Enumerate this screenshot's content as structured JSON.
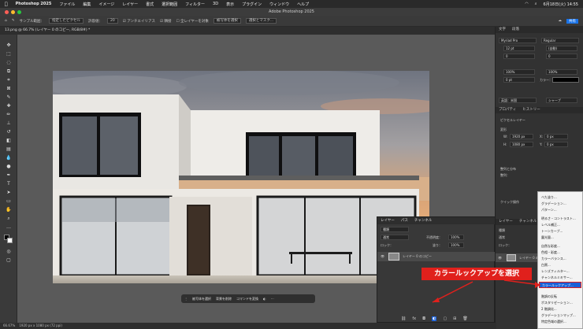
{
  "menubar": {
    "app": "Photoshop 2025",
    "items": [
      "ファイル",
      "編集",
      "イメージ",
      "レイヤー",
      "書式",
      "選択範囲",
      "フィルター",
      "3D",
      "表示",
      "プラグイン",
      "ウィンドウ",
      "ヘルプ"
    ],
    "clock": "6月18日(火) 14:55"
  },
  "titlebar": {
    "title": "Adobe Photoshop 2025"
  },
  "options": {
    "sample_size_label": "サンプル範囲：",
    "sample_size": "指定したピクセル",
    "tolerance_label": "許容値：",
    "tolerance": "20",
    "antialias": "アンチエイリアス",
    "contiguous": "隣接",
    "all_layers": "全レイヤーを対象",
    "select_subject": "被写体を選択",
    "select_mask": "選択とマスク..."
  },
  "document": {
    "tab": "13.png @ 66.7% (レイヤー 0 のコピー, RGB/8#) *"
  },
  "status": {
    "zoom": "66.67%",
    "info": "1920 px x 1080 px (72 ppi)"
  },
  "context_bar": {
    "btn1": "被写体を選択",
    "btn2": "背景を削除",
    "btn3": "コマンドを変換"
  },
  "right_panel": {
    "char_tab": "文字",
    "para_tab": "段落",
    "font": "Myriad Pro",
    "style": "Regular",
    "size": "12 pt",
    "leading": "(自動)",
    "tracking": "0",
    "kern": "0",
    "scale_v": "100%",
    "scale_h": "100%",
    "baseline": "0 pt",
    "color_label": "カラー：",
    "lang": "英語：米国",
    "aa": "シャープ",
    "props_tab": "プロパティ",
    "hist_tab": "ヒストリー",
    "pixel_layer": "ピクセルレイヤー",
    "transform": "変形",
    "w": "1920 px",
    "h": "1080 px",
    "x": "0 px",
    "y": "0 px",
    "align": "整列と分布",
    "arrange": "整列：",
    "quick": "クイック操作",
    "layers_tab": "レイヤー",
    "channels_tab": "チャンネル",
    "kind": "種類",
    "lock": "ロック：",
    "mode": "通常",
    "layer_name": "レイヤー 0 のコピー"
  },
  "layers_panel": {
    "tabs": [
      "レイヤー",
      "パス",
      "チャンネル"
    ],
    "kind": "種類",
    "mode": "通常",
    "opacity_label": "不透明度：",
    "opacity": "100%",
    "lock": "ロック：",
    "fill_label": "塗り：",
    "fill": "100%",
    "layer_name": "レイヤー 0 のコピー"
  },
  "adj_menu": {
    "items": [
      "べた塗り...",
      "グラデーション...",
      "パターン...",
      "明るさ・コントラスト...",
      "レベル補正...",
      "トーンカーブ...",
      "露光量...",
      "自然な彩度...",
      "色相・彩度...",
      "カラーバランス...",
      "白黒...",
      "レンズフィルター...",
      "チャンネルミキサー...",
      "カラールックアップ...",
      "階調の反転",
      "ポスタリゼーション...",
      "2 階調化...",
      "グラデーションマップ...",
      "特定色域の選択..."
    ],
    "highlighted_index": 13
  },
  "callout": {
    "text": "カラールックアップを選択"
  },
  "colors": {
    "accent": "#e0201c",
    "highlight": "#1a5fd6"
  }
}
